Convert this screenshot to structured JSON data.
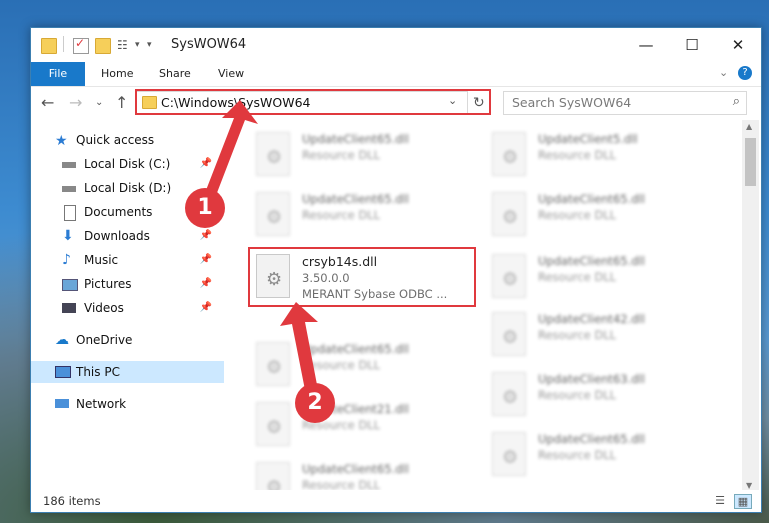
{
  "window": {
    "title": "SysWOW64",
    "controls": {
      "minimize": "—",
      "maximize": "☐",
      "close": "✕"
    }
  },
  "ribbon": {
    "file_label": "File",
    "tabs": [
      "Home",
      "Share",
      "View"
    ]
  },
  "address": {
    "path": "C:\\Windows\\SysWOW64"
  },
  "search": {
    "placeholder": "Search SysWOW64"
  },
  "sidebar": {
    "items": [
      {
        "label": "Quick access",
        "icon": "star-icon"
      },
      {
        "label": "Local Disk (C:)",
        "icon": "drive-icon"
      },
      {
        "label": "Local Disk (D:)",
        "icon": "drive-icon"
      },
      {
        "label": "Documents",
        "icon": "documents-icon"
      },
      {
        "label": "Downloads",
        "icon": "download-icon"
      },
      {
        "label": "Music",
        "icon": "music-icon"
      },
      {
        "label": "Pictures",
        "icon": "pictures-icon"
      },
      {
        "label": "Videos",
        "icon": "videos-icon"
      },
      {
        "label": "OneDrive",
        "icon": "cloud-icon"
      },
      {
        "label": "This PC",
        "icon": "computer-icon"
      },
      {
        "label": "Network",
        "icon": "network-icon"
      }
    ]
  },
  "files": {
    "left": [
      {
        "name": "UpdateClient65.dll",
        "desc": "Resource DLL"
      },
      {
        "name": "UpdateClient65.dll",
        "desc": "Resource DLL"
      },
      {
        "name": "crsyb14s.dll",
        "version": "3.50.0.0",
        "desc": "MERANT Sybase ODBC ..."
      },
      {
        "name": "UpdateClient65.dll",
        "desc": "Resource DLL"
      },
      {
        "name": "UpdateClient21.dll",
        "desc": "Resource DLL"
      },
      {
        "name": "UpdateClient65.dll",
        "desc": "Resource DLL"
      }
    ],
    "right": [
      {
        "name": "UpdateClient5.dll",
        "desc": "Resource DLL"
      },
      {
        "name": "UpdateClient65.dll",
        "desc": "Resource DLL"
      },
      {
        "name": "UpdateClient65.dll",
        "desc": "Resource DLL"
      },
      {
        "name": "UpdateClient42.dll",
        "desc": "Resource DLL"
      },
      {
        "name": "UpdateClient63.dll",
        "desc": "Resource DLL"
      },
      {
        "name": "UpdateClient65.dll",
        "desc": "Resource DLL"
      }
    ]
  },
  "status": {
    "items_count": "186 items"
  },
  "annotations": {
    "step1": "1",
    "step2": "2"
  },
  "colors": {
    "accent": "#1979ca",
    "highlight": "#e0393e",
    "selected": "#cce8ff"
  }
}
